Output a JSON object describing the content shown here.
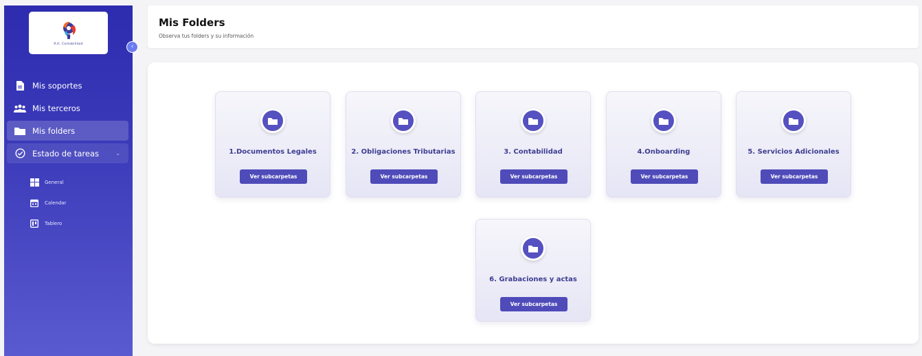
{
  "sidebar": {
    "logo_text": "R.H. Contabilidad",
    "collapse_icon": "chevron-left-icon",
    "items": [
      {
        "label": "Mis soportes",
        "icon": "document-icon"
      },
      {
        "label": "Mis terceros",
        "icon": "users-icon"
      },
      {
        "label": "Mis folders",
        "icon": "folder-icon",
        "active": true
      },
      {
        "label": "Estado de tareas",
        "icon": "check-circle-icon",
        "expandable": true
      }
    ],
    "subitems": [
      {
        "label": "General",
        "icon": "grid-icon"
      },
      {
        "label": "Calendar",
        "icon": "calendar-icon"
      },
      {
        "label": "Tablero",
        "icon": "board-icon"
      }
    ]
  },
  "header": {
    "title": "Mis Folders",
    "subtitle": "Observa tus folders y su información"
  },
  "folders": [
    {
      "title": "1.Documentos Legales",
      "button": "Ver subcarpetas"
    },
    {
      "title": "2. Obligaciones Tributarias",
      "button": "Ver subcarpetas"
    },
    {
      "title": "3. Contabilidad",
      "button": "Ver subcarpetas"
    },
    {
      "title": "4.Onboarding",
      "button": "Ver subcarpetas"
    },
    {
      "title": "5. Servicios Adicionales",
      "button": "Ver subcarpetas"
    },
    {
      "title": "6. Grabaciones y actas",
      "button": "Ver subcarpetas"
    }
  ],
  "colors": {
    "sidebar_top": "#2d2cb0",
    "sidebar_bottom": "#5a5ad0",
    "accent": "#4f4bb9",
    "folder_title": "#3e3d91"
  }
}
